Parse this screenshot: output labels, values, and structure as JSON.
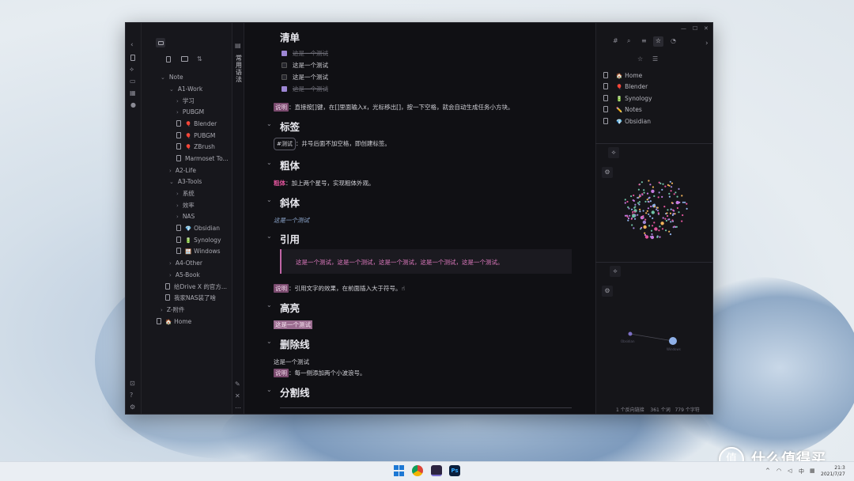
{
  "window": {
    "controls": [
      "—",
      "☐",
      "✕"
    ],
    "collapse_left": "‹",
    "collapse_right": "›"
  },
  "explorer": {
    "items": [
      {
        "label": "Note",
        "type": "folder-open"
      },
      {
        "label": "A1-Work",
        "type": "folder-open"
      },
      {
        "label": "学习",
        "type": "folder"
      },
      {
        "label": "PUBGM",
        "type": "folder"
      },
      {
        "label": "Blender",
        "type": "file",
        "emoji": "🎈"
      },
      {
        "label": "PUBGM",
        "type": "file",
        "emoji": "🎈"
      },
      {
        "label": "ZBrush",
        "type": "file",
        "emoji": "🎈"
      },
      {
        "label": "Marmoset To...",
        "type": "file",
        "emoji": ""
      },
      {
        "label": "A2-Life",
        "type": "folder"
      },
      {
        "label": "A3-Tools",
        "type": "folder-open"
      },
      {
        "label": "系统",
        "type": "folder"
      },
      {
        "label": "效率",
        "type": "folder"
      },
      {
        "label": "NAS",
        "type": "folder"
      },
      {
        "label": "Obsidian",
        "type": "file",
        "emoji": "💎"
      },
      {
        "label": "Synology",
        "type": "file",
        "emoji": "🔋"
      },
      {
        "label": "Windows",
        "type": "file",
        "emoji": "🪟"
      },
      {
        "label": "A4-Other",
        "type": "folder"
      },
      {
        "label": "A5-Book",
        "type": "folder"
      },
      {
        "label": "给Drive X 的官方...",
        "type": "file",
        "emoji": ""
      },
      {
        "label": "我家NAS装了啥",
        "type": "file",
        "emoji": ""
      },
      {
        "label": "Z-附件",
        "type": "folder"
      },
      {
        "label": "Home",
        "type": "file",
        "emoji": "🏠"
      }
    ]
  },
  "sidestrip": {
    "vertical_label": "常用语法"
  },
  "editor": {
    "heading_list": "清单",
    "todo": [
      {
        "text": "这是一个测试",
        "done": true
      },
      {
        "text": "这是一个测试",
        "done": false
      },
      {
        "text": "这是一个测试",
        "done": false
      },
      {
        "text": "这是一个测试",
        "done": true
      }
    ],
    "note_tag": "说明",
    "list_desc": "：直接按[]键，在[]里面输入x，光标移出[]，按一下空格，就会自动生成任务小方块。",
    "heading_tag": "标签",
    "tag_example": "#测试",
    "tag_desc": "：井号后面不加空格，即创建标签。",
    "heading_bold": "粗体",
    "bold_word": "粗体",
    "bold_desc": "：加上两个星号，实现粗体外观。",
    "heading_italic": "斜体",
    "italic_example": "这是一个测试",
    "heading_quote": "引用",
    "quote_text": "这是一个测试，这是一个测试，这是一个测试，这是一个测试，这是一个测试。",
    "quote_desc": "：引用文字的效果，在前面插入大于符号。☝",
    "heading_highlight": "高亮",
    "highlight_example": "这是一个测试",
    "heading_strike": "删除线",
    "strike_example": "这是一个测试",
    "strike_desc": "：每一侧添加两个小波浪号。",
    "heading_hr": "分割线"
  },
  "right_panel": {
    "bookmarks": [
      {
        "label": "Home",
        "emoji": "🏠"
      },
      {
        "label": "Blender",
        "emoji": "🎈"
      },
      {
        "label": "Synology",
        "emoji": "🔋"
      },
      {
        "label": "Notes",
        "emoji": "✏️"
      },
      {
        "label": "Obsidian",
        "emoji": "💎"
      }
    ],
    "local_graph_label_left": "Obsidian",
    "local_graph_label_right": "Windows"
  },
  "status_bar": {
    "backlinks": "1 个反向链接",
    "words": "361 个词",
    "chars": "779 个字符"
  },
  "taskbar": {
    "time": "21:3",
    "date": "2021/7/27"
  },
  "watermark": {
    "logo": "值",
    "text": "什么值得买"
  },
  "colors": {
    "accent_purple": "#9d86d4",
    "highlight_pink": "#e2559d",
    "quote_pink": "#e07ac0",
    "background": "#101014"
  }
}
